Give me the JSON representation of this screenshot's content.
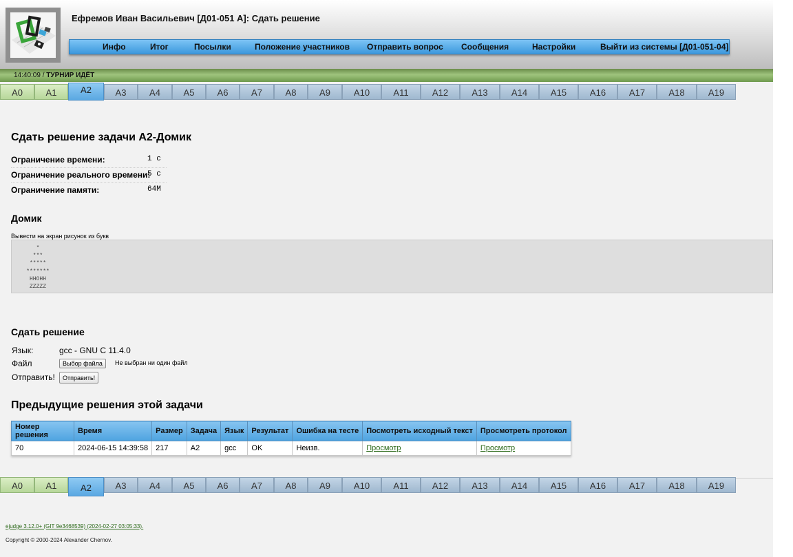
{
  "header": {
    "title": "Ефремов Иван Васильевич [Д01-051 А]: Сдать решение",
    "menu": [
      "Инфо",
      "Итог",
      "Посылки",
      "Положение участников",
      "Отправить вопрос",
      "Сообщения",
      "Настройки",
      "Выйти из системы [Д01-051-04]"
    ]
  },
  "status": {
    "time": "14:40:09 /",
    "state": "ТУРНИР ИДЁТ"
  },
  "tabs": [
    "A0",
    "A1",
    "A2",
    "A3",
    "A4",
    "A5",
    "A6",
    "A7",
    "A8",
    "A9",
    "A10",
    "A11",
    "A12",
    "A13",
    "A14",
    "A15",
    "A16",
    "A17",
    "A18",
    "A19"
  ],
  "tabs_active": "A2",
  "problem": {
    "heading": "Сдать решение задачи A2-Домик",
    "limits": [
      {
        "label": "Ограничение времени:",
        "value": "1 с"
      },
      {
        "label": "Ограничение реального времени:",
        "value": "5 с"
      },
      {
        "label": "Ограничение памяти:",
        "value": "64M"
      }
    ],
    "name": "Домик",
    "statement": "Вывести на экран рисунок из букв",
    "example": [
      "*",
      "***",
      "*****",
      "*******",
      "HHOHH",
      "ZZZZZ"
    ]
  },
  "submit": {
    "heading": "Сдать решение",
    "language_label": "Язык:",
    "language_value": "gcc - GNU C 11.4.0",
    "file_label": "Файл",
    "file_button": "Выбор файла",
    "file_status": "Не выбран ни один файл",
    "send_label": "Отправить!",
    "send_button": "Отправить!"
  },
  "runs": {
    "heading": "Предыдущие решения этой задачи",
    "columns": [
      "Номер решения",
      "Время",
      "Размер",
      "Задача",
      "Язык",
      "Результат",
      "Ошибка на тесте",
      "Посмотреть исходный текст",
      "Просмотреть протокол"
    ],
    "rows": [
      [
        "70",
        "2024-06-15 14:39:58",
        "217",
        "A2",
        "gcc",
        "OK",
        "Неизв.",
        "Просмотр",
        "Просмотр"
      ]
    ]
  },
  "footer": {
    "version": "ejudge 3.12.0+ (GIT 9e3468539) (2024-02-27 03:05:33).",
    "copyright": "Copyright © 2000-2024 Alexander Chernov."
  },
  "colors": {
    "menu_blue": "#4ea3e0",
    "status_green": "#9fc47d",
    "link_green": "#2d6a1b"
  },
  "icons": {
    "logo": "ejudge-logo-icon"
  }
}
